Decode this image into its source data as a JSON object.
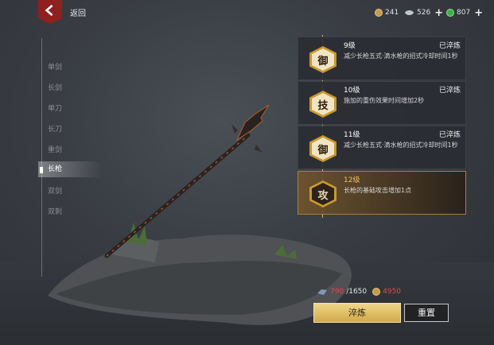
{
  "header": {
    "back_label": "返回",
    "currencies": [
      {
        "icon": "copper-coin-icon",
        "value": "241",
        "has_plus": false
      },
      {
        "icon": "silver-ingot-icon",
        "value": "526",
        "has_plus": true
      },
      {
        "icon": "jade-gem-icon",
        "value": "807",
        "has_plus": true
      }
    ]
  },
  "categories": [
    {
      "label": "单剑",
      "active": false
    },
    {
      "label": "长剑",
      "active": false
    },
    {
      "label": "单刀",
      "active": false
    },
    {
      "label": "长刀",
      "active": false
    },
    {
      "label": "重剑",
      "active": false
    },
    {
      "label": "长枪",
      "active": true
    },
    {
      "label": "双剑",
      "active": false
    },
    {
      "label": "双刺",
      "active": false
    }
  ],
  "talents": [
    {
      "glyph": "御",
      "level": "9级",
      "status": "已淬炼",
      "desc": "减少长枪五式·滴水枪的招式冷却时间1秒",
      "active": false
    },
    {
      "glyph": "技",
      "level": "10级",
      "status": "已淬炼",
      "desc": "施加的重伤效果时间增加2秒",
      "active": false
    },
    {
      "glyph": "御",
      "level": "11级",
      "status": "已淬炼",
      "desc": "减少长枪五式·滴水枪的招式冷却时间1秒",
      "active": false
    },
    {
      "glyph": "攻",
      "level": "12级",
      "status": "",
      "desc": "长枪的基础攻击增加1点",
      "active": true
    }
  ],
  "cost": {
    "material_have": "790",
    "material_need": "/1650",
    "coin_cost": "4950"
  },
  "buttons": {
    "refine": "淬炼",
    "reset": "重置"
  },
  "colors": {
    "accent_gold": "#d1a948",
    "back_red": "#8f2020",
    "insufficient_red": "#e04a4a"
  }
}
